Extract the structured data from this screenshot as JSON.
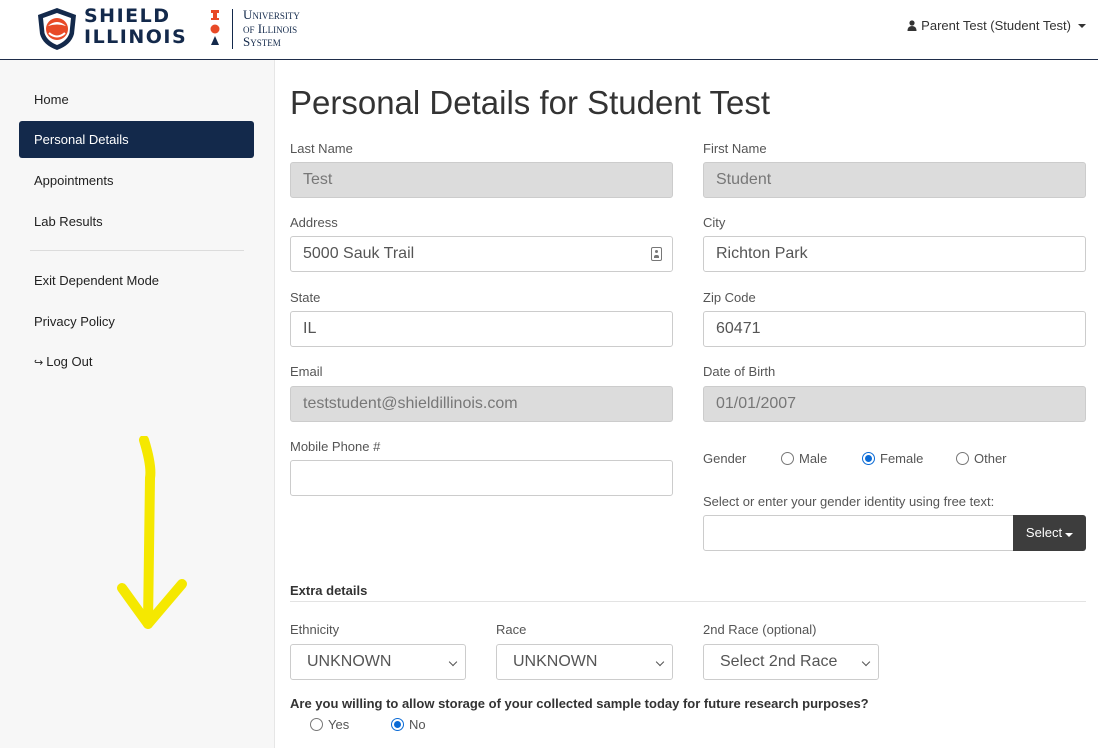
{
  "header": {
    "logo_text_line1": "SHIELD",
    "logo_text_line2": "ILLINOIS",
    "uofi_line1": "University",
    "uofi_line2": "of Illinois",
    "uofi_line3": "System",
    "user_label": "Parent Test (Student Test)",
    "user_icon": "user-icon"
  },
  "sidebar": {
    "items": [
      {
        "label": "Home"
      },
      {
        "label": "Personal Details",
        "active": true
      },
      {
        "label": "Appointments"
      },
      {
        "label": "Lab Results"
      },
      {
        "label": "Exit Dependent Mode"
      },
      {
        "label": "Privacy Policy"
      },
      {
        "label": "Log Out",
        "icon": "logout-icon"
      }
    ]
  },
  "page": {
    "title": "Personal Details for Student Test"
  },
  "form": {
    "last_name": {
      "label": "Last Name",
      "value": "Test"
    },
    "first_name": {
      "label": "First Name",
      "value": "Student"
    },
    "address": {
      "label": "Address",
      "value": "5000 Sauk Trail"
    },
    "city": {
      "label": "City",
      "value": "Richton Park"
    },
    "state": {
      "label": "State",
      "value": "IL"
    },
    "zip": {
      "label": "Zip Code",
      "value": "60471"
    },
    "email": {
      "label": "Email",
      "value": "teststudent@shieldillinois.com"
    },
    "dob": {
      "label": "Date of Birth",
      "value": "01/01/2007"
    },
    "mobile": {
      "label": "Mobile Phone #",
      "value": ""
    },
    "gender": {
      "label": "Gender",
      "options": [
        "Male",
        "Female",
        "Other"
      ],
      "selected": "Female"
    },
    "gender_identity": {
      "label": "Select or enter your gender identity using free text:",
      "value": "",
      "button": "Select"
    }
  },
  "extra": {
    "heading": "Extra details",
    "ethnicity": {
      "label": "Ethnicity",
      "value": "UNKNOWN"
    },
    "race": {
      "label": "Race",
      "value": "UNKNOWN"
    },
    "race2": {
      "label": "2nd Race (optional)",
      "value": "Select 2nd Race"
    },
    "research_question": "Are you willing to allow storage of your collected sample today for future research purposes?",
    "research_options": [
      "Yes",
      "No"
    ],
    "research_selected": "No"
  },
  "colors": {
    "brand_navy": "#13294b",
    "accent_orange": "#e84a27",
    "radio_blue": "#0b6bd6",
    "annotation_yellow": "#f5e800"
  }
}
